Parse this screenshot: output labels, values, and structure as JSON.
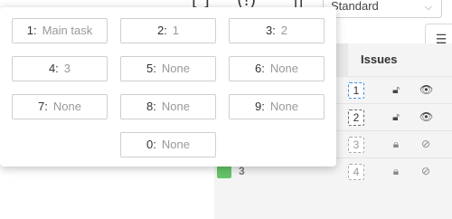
{
  "toolbar": {
    "paren_glyph": "(!)",
    "pause_glyph": "||",
    "bracket_glyph": "[ ]"
  },
  "dropdown": {
    "selected": "Standard",
    "chevron_icon": "chevron-down-icon"
  },
  "grid": {
    "issues_header": "Issues",
    "rows": [
      {
        "issue": "1",
        "locked": false,
        "visible": true,
        "state": "active"
      },
      {
        "issue": "2",
        "locked": false,
        "visible": true,
        "state": "normal"
      },
      {
        "issue": "3",
        "locked": true,
        "visible": false,
        "state": "muted"
      },
      {
        "issue": "4",
        "locked": true,
        "visible": false,
        "state": "muted",
        "label": "3",
        "swatch_color": "#66c36a"
      }
    ]
  },
  "slots": [
    {
      "key": "1:",
      "value": "Main task"
    },
    {
      "key": "2:",
      "value": "1"
    },
    {
      "key": "3:",
      "value": "2"
    },
    {
      "key": "4:",
      "value": "3"
    },
    {
      "key": "5:",
      "value": "None"
    },
    {
      "key": "6:",
      "value": "None"
    },
    {
      "key": "7:",
      "value": "None"
    },
    {
      "key": "8:",
      "value": "None"
    },
    {
      "key": "9:",
      "value": "None"
    },
    {
      "key": "0:",
      "value": "None"
    }
  ]
}
